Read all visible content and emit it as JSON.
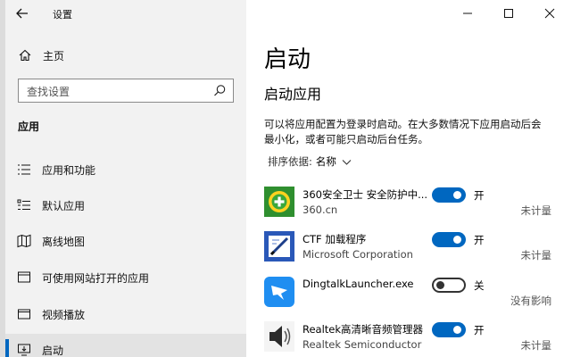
{
  "window": {
    "title": "设置",
    "controls": [
      "minimize-icon",
      "maximize-icon",
      "close-icon"
    ]
  },
  "nav": {
    "home_label": "主页",
    "search_placeholder": "查找设置",
    "section_title": "应用",
    "items": [
      {
        "label": "应用和功能",
        "icon": "apps-features-icon"
      },
      {
        "label": "默认应用",
        "icon": "default-apps-icon"
      },
      {
        "label": "离线地图",
        "icon": "offline-maps-icon"
      },
      {
        "label": "可使用网站打开的应用",
        "icon": "apps-for-websites-icon"
      },
      {
        "label": "视频播放",
        "icon": "video-playback-icon"
      },
      {
        "label": "启动",
        "icon": "startup-icon",
        "selected": true
      }
    ]
  },
  "main": {
    "page_title": "启动",
    "subtitle": "启动应用",
    "description": "可以将应用配置为登录时启动。在大多数情况下应用启动后会最小化，或者可能只启动后台任务。",
    "sort_label": "排序依据:",
    "sort_value": "名称",
    "apps": [
      {
        "name": "360安全卫士 安全防护中...",
        "publisher": "360.cn",
        "enabled": true,
        "state_label": "开",
        "impact": "未计量",
        "icon": "360-safe-icon"
      },
      {
        "name": "CTF 加载程序",
        "publisher": "Microsoft Corporation",
        "enabled": true,
        "state_label": "开",
        "impact": "未计量",
        "icon": "ctf-loader-icon"
      },
      {
        "name": "DingtalkLauncher.exe",
        "publisher": "",
        "enabled": false,
        "state_label": "关",
        "impact": "没有影响",
        "icon": "dingtalk-icon"
      },
      {
        "name": "Realtek高清晰音频管理器",
        "publisher": "Realtek Semiconductor",
        "enabled": true,
        "state_label": "开",
        "impact": "未计量",
        "icon": "realtek-audio-icon"
      }
    ]
  },
  "colors": {
    "accent": "#0067c0",
    "nav_bg": "#f2f2f2",
    "selected_bg": "#e3e3e3"
  }
}
